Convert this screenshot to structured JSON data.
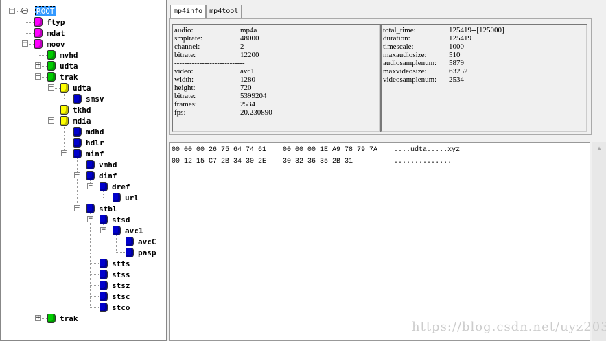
{
  "colors": {
    "magenta": "#ff00ff",
    "green": "#00cc00",
    "yellow": "#ffff00",
    "blue": "#0000cc",
    "selection": "#3399ff"
  },
  "tree": [
    {
      "label": "ROOT",
      "depth": 0,
      "exp": "-",
      "color": "root"
    },
    {
      "label": "ftyp",
      "depth": 1,
      "color": "magenta"
    },
    {
      "label": "mdat",
      "depth": 1,
      "color": "magenta"
    },
    {
      "label": "moov",
      "depth": 1,
      "exp": "-",
      "color": "magenta"
    },
    {
      "label": "mvhd",
      "depth": 2,
      "color": "green"
    },
    {
      "label": "udta",
      "depth": 2,
      "exp": "+",
      "color": "green"
    },
    {
      "label": "trak",
      "depth": 2,
      "exp": "-",
      "color": "green"
    },
    {
      "label": "udta",
      "depth": 3,
      "exp": "-",
      "color": "yellow"
    },
    {
      "label": "smsv",
      "depth": 4,
      "color": "blue"
    },
    {
      "label": "tkhd",
      "depth": 3,
      "color": "yellow"
    },
    {
      "label": "mdia",
      "depth": 3,
      "exp": "-",
      "color": "yellow"
    },
    {
      "label": "mdhd",
      "depth": 4,
      "color": "blue"
    },
    {
      "label": "hdlr",
      "depth": 4,
      "color": "blue"
    },
    {
      "label": "minf",
      "depth": 4,
      "exp": "-",
      "color": "blue"
    },
    {
      "label": "vmhd",
      "depth": 5,
      "color": "blue"
    },
    {
      "label": "dinf",
      "depth": 5,
      "exp": "-",
      "color": "blue"
    },
    {
      "label": "dref",
      "depth": 6,
      "exp": "-",
      "color": "blue"
    },
    {
      "label": "url",
      "depth": 7,
      "color": "blue"
    },
    {
      "label": "stbl",
      "depth": 5,
      "exp": "-",
      "color": "blue"
    },
    {
      "label": "stsd",
      "depth": 6,
      "exp": "-",
      "color": "blue"
    },
    {
      "label": "avc1",
      "depth": 7,
      "exp": "-",
      "color": "blue"
    },
    {
      "label": "avcC",
      "depth": 8,
      "color": "blue"
    },
    {
      "label": "pasp",
      "depth": 8,
      "color": "blue"
    },
    {
      "label": "stts",
      "depth": 6,
      "color": "blue"
    },
    {
      "label": "stss",
      "depth": 6,
      "color": "blue"
    },
    {
      "label": "stsz",
      "depth": 6,
      "color": "blue"
    },
    {
      "label": "stsc",
      "depth": 6,
      "color": "blue"
    },
    {
      "label": "stco",
      "depth": 6,
      "color": "blue"
    },
    {
      "label": "trak",
      "depth": 2,
      "exp": "+",
      "color": "green"
    }
  ],
  "tabs": [
    "mp4info",
    "mp4tool"
  ],
  "info_left": [
    [
      "audio:",
      "mp4a"
    ],
    [
      "smplrate:",
      "48000"
    ],
    [
      "channel:",
      "2"
    ],
    [
      "bitrate:",
      "12200"
    ],
    [
      "----------------------------",
      ""
    ],
    [
      "video:",
      "avc1"
    ],
    [
      "width:",
      "1280"
    ],
    [
      "height:",
      "720"
    ],
    [
      "bitrate:",
      "5399204"
    ],
    [
      "frames:",
      "2534"
    ],
    [
      "fps:",
      "20.230890"
    ]
  ],
  "info_right": [
    [
      "total_time:",
      "125419--[125000]"
    ],
    [
      "duration:",
      "125419"
    ],
    [
      "timescale:",
      "1000"
    ],
    [
      "maxaudiosize:",
      "510"
    ],
    [
      "audiosamplenum:",
      "5879"
    ],
    [
      "maxvideosize:",
      "63252"
    ],
    [
      "videosamplenum:",
      "2534"
    ]
  ],
  "hex": [
    "00 00 00 26 75 64 74 61    00 00 00 1E A9 78 79 7A    ....udta.....xyz",
    "00 12 15 C7 2B 34 30 2E    30 32 36 35 2B 31          .............."
  ],
  "watermark": "https://blog.csdn.net/uyz203"
}
